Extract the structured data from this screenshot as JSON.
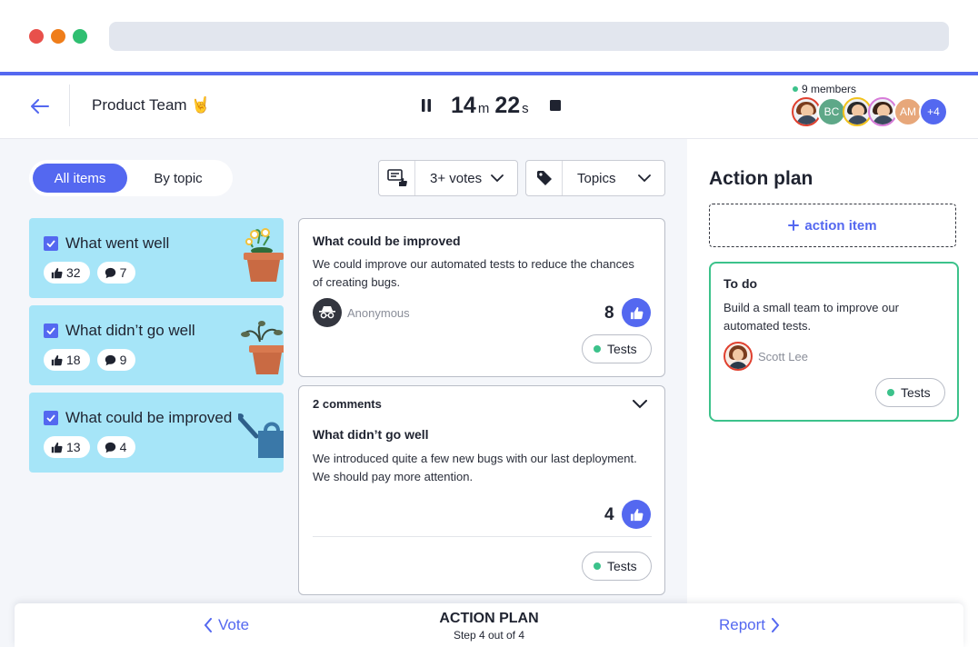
{
  "colors": {
    "accent": "#5468f0",
    "category_bg": "#a6e5f8",
    "online": "#3cc28b",
    "tag_dot": "#3cc28b",
    "dot_red": "#e8504b",
    "dot_orange": "#ef7d1a",
    "dot_green": "#2fbf71"
  },
  "header": {
    "team_name": "Product Team 🤘",
    "timer": {
      "minutes": "14",
      "minutes_unit": "m",
      "seconds": "22",
      "seconds_unit": "s"
    },
    "members_label": "9 members",
    "avatars": [
      {
        "type": "photo",
        "hair": "#7a3c1e",
        "ring": "#e0402f"
      },
      {
        "type": "initials",
        "text": "BC",
        "bg": "#5ea888"
      },
      {
        "type": "photo",
        "hair": "#2a2a2a",
        "ring": "#f2c21c"
      },
      {
        "type": "photo",
        "hair": "#3b2418",
        "ring": "#d77bd8"
      },
      {
        "type": "initials",
        "text": "AM",
        "bg": "#e7a77a"
      },
      {
        "type": "initials",
        "text": "+4",
        "bg": "#5468f0"
      }
    ]
  },
  "toolbar": {
    "view_all": "All items",
    "view_topic": "By topic",
    "votes_filter": "3+ votes",
    "topics_filter": "Topics"
  },
  "categories": [
    {
      "title": "What went well",
      "likes": "32",
      "comments": "7",
      "illustration": "flower-pot"
    },
    {
      "title": "What didn’t go well",
      "likes": "18",
      "comments": "9",
      "illustration": "wilted-plant"
    },
    {
      "title": "What could be improved",
      "likes": "13",
      "comments": "4",
      "illustration": "watering-can"
    }
  ],
  "cards": [
    {
      "title": "What could be improved",
      "text": "We could improve our automated tests to reduce the chances of creating bugs.",
      "author": "Anonymous",
      "votes": "8",
      "tag": "Tests"
    },
    {
      "comments_label": "2 comments",
      "title": "What didn’t go well",
      "text": "We introduced quite a few new bugs with our last deployment. We should pay more attention.",
      "votes": "4",
      "tag": "Tests"
    }
  ],
  "action_plan": {
    "title": "Action plan",
    "add_label": "action item",
    "todo": {
      "status": "To do",
      "text": "Build a small team to improve our automated tests.",
      "assignee": "Scott Lee",
      "tag": "Tests"
    }
  },
  "bottom_nav": {
    "prev_label": "Vote",
    "step_title": "ACTION PLAN",
    "step_sub": "Step 4 out of 4",
    "next_label": "Report"
  }
}
